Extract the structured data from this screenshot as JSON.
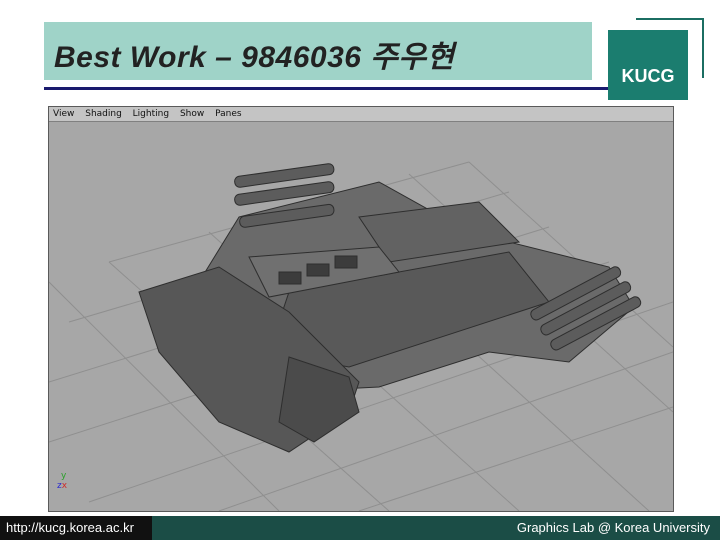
{
  "slide": {
    "title": "Best Work – 9846036 주우현",
    "logo_text": "KUCG"
  },
  "viewport": {
    "menu": [
      "View",
      "Shading",
      "Lighting",
      "Show",
      "Panes"
    ],
    "axis_y": "y",
    "axis_z": "z",
    "axis_x": "x"
  },
  "footer": {
    "url": "http://kucg.korea.ac.kr",
    "credit": "Graphics Lab @ Korea University"
  },
  "colors": {
    "title_bg": "#9fd3c8",
    "logo_bg": "#1b7d6f",
    "footer_bg": "#1b4d46",
    "viewport_bg": "#a5a5a5"
  }
}
